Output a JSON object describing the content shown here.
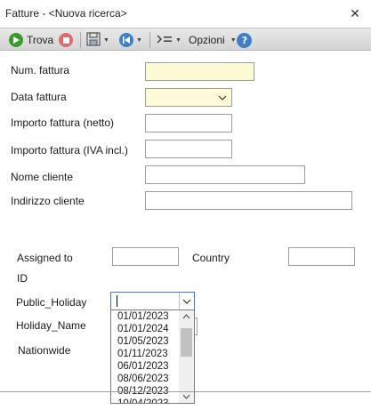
{
  "window": {
    "title": "Fatture - <Nuova ricerca>",
    "close_glyph": "✕"
  },
  "toolbar": {
    "find_label": "Trova",
    "options_label": "Opzioni",
    "icons": {
      "find": "play-icon",
      "stop": "stop-icon",
      "save": "save-icon",
      "back": "back-icon",
      "fields": "fields-icon",
      "help": "help-icon"
    },
    "colors": {
      "find": "#3a9a2c",
      "stop": "#e06a6a",
      "back": "#3f7fc8",
      "help": "#3f7fc8"
    }
  },
  "form": {
    "num_fattura": {
      "label": "Num. fattura",
      "value": ""
    },
    "data_fattura": {
      "label": "Data fattura",
      "value": ""
    },
    "importo_netto": {
      "label": "Importo fattura (netto)",
      "value": ""
    },
    "importo_iva": {
      "label": "Importo fattura (IVA incl.)",
      "value": ""
    },
    "nome_cliente": {
      "label": "Nome cliente",
      "value": ""
    },
    "indirizzo_cliente": {
      "label": "Indirizzo cliente",
      "value": ""
    }
  },
  "portal": {
    "assigned_to_label_1": "Assigned to",
    "assigned_to_label_2": "ID",
    "country_label": "Country",
    "public_holiday_label": "Public_Holiday",
    "holiday_name_label": "Holiday_Name",
    "nationwide_label": "Nationwide",
    "public_holiday_value": "",
    "holiday_options": [
      "01/01/2023",
      "01/01/2024",
      "01/05/2023",
      "01/11/2023",
      "06/01/2023",
      "08/06/2023",
      "08/12/2023",
      "10/04/2023"
    ]
  },
  "colors": {
    "required_field_bg": "#fdfbd6",
    "focus_border": "#3b78c9"
  }
}
